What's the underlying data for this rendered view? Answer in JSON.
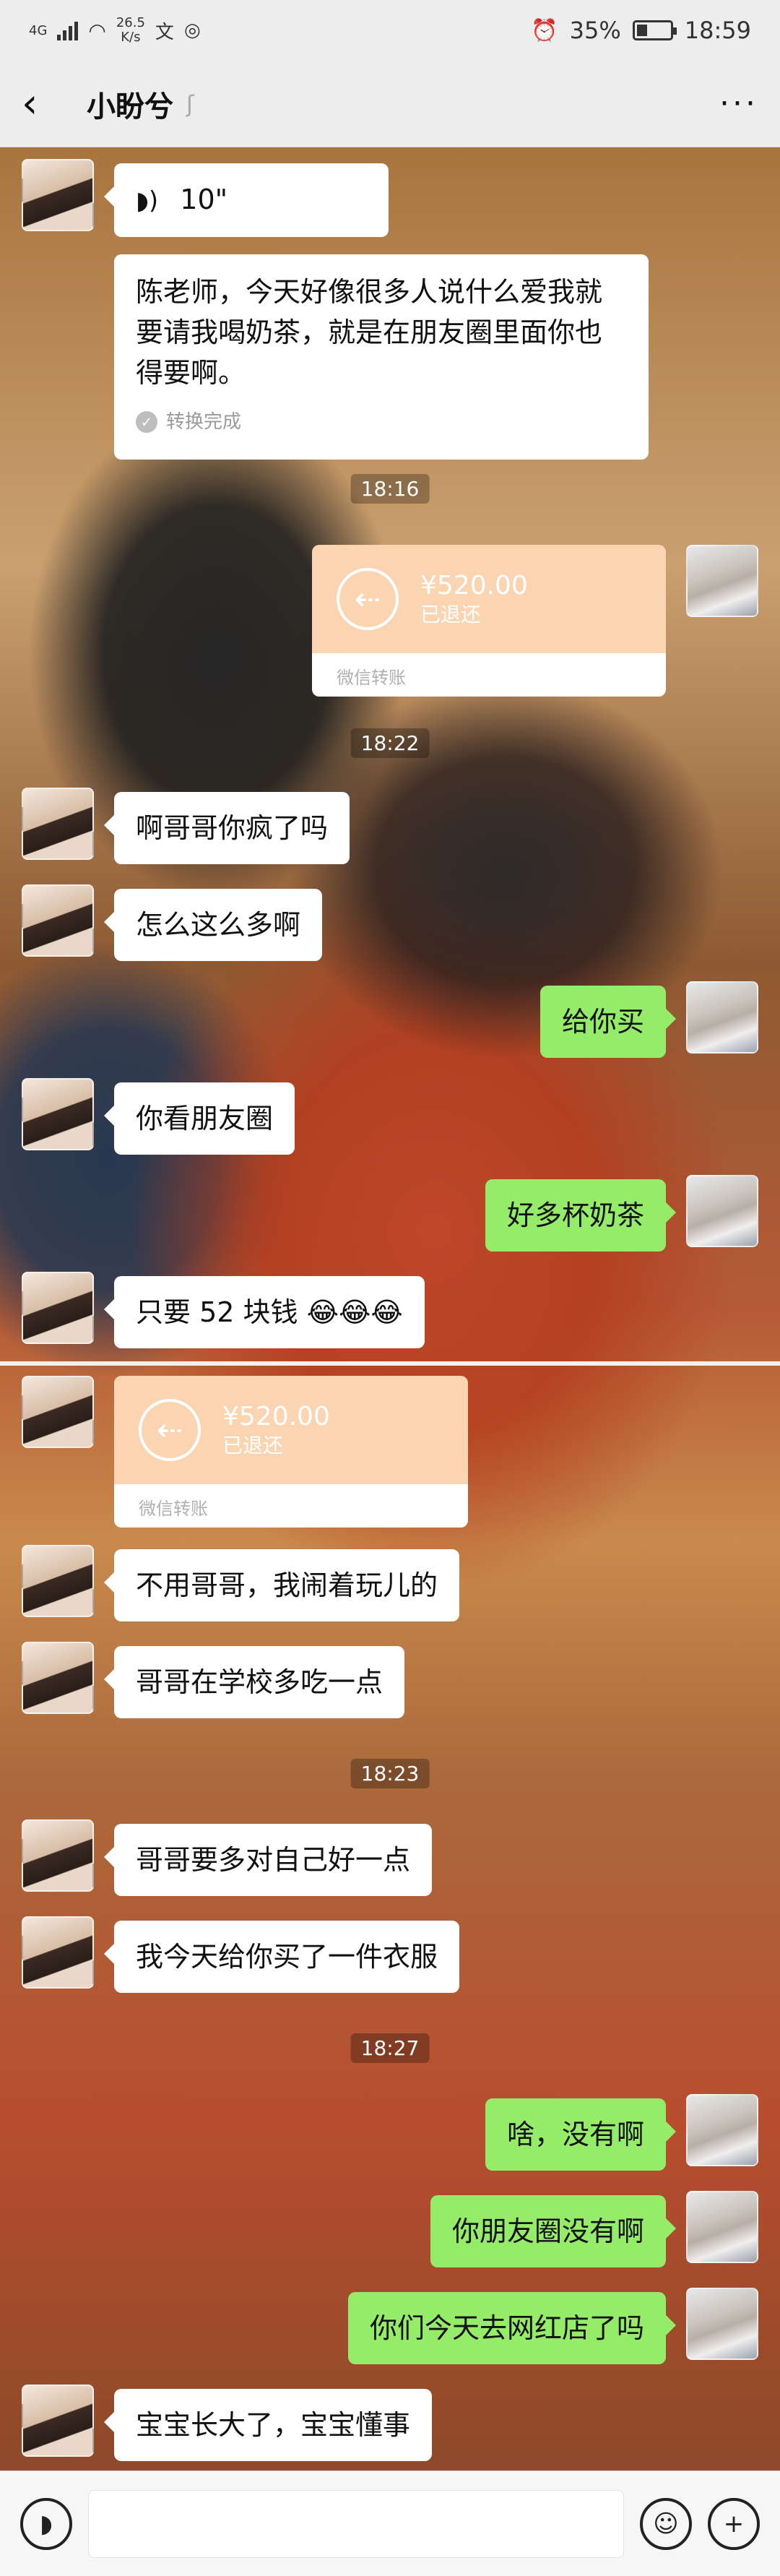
{
  "status_bar": {
    "network": "4G",
    "speed_value": "26.5",
    "speed_unit": "K/s",
    "battery": "35%",
    "time": "18:59"
  },
  "header": {
    "title": "小盼兮",
    "back_icon": "chevron-left-icon",
    "more_icon": "more-dots-icon"
  },
  "messages": {
    "voice_duration": "10\"",
    "voice_text": "陈老师，今天好像很多人说什么爱我就要请我喝奶茶，就是在朋友圈里面你也得要啊。",
    "convert_done": "转换完成",
    "time1": "18:16",
    "transfer1_amount": "¥520.00",
    "transfer1_status": "已退还",
    "transfer1_label": "微信转账",
    "time2": "18:22",
    "m1": "啊哥哥你疯了吗",
    "m2": "怎么这么多啊",
    "m3": "给你买",
    "m4": "你看朋友圈",
    "m5": "好多杯奶茶",
    "m6": "只要 52 块钱",
    "m6_emoji": "😂😂😂",
    "transfer2_amount": "¥520.00",
    "transfer2_status": "已退还",
    "transfer2_label": "微信转账",
    "m7": "不用哥哥，我闹着玩儿的",
    "m8": "哥哥在学校多吃一点",
    "time3": "18:23",
    "m9": "哥哥要多对自己好一点",
    "m10": "我今天给你买了一件衣服",
    "time4": "18:27",
    "m11": "啥，没有啊",
    "m12": "你朋友圈没有啊",
    "m13": "你们今天去网红店了吗",
    "m14": "宝宝长大了，宝宝懂事"
  },
  "input_bar": {
    "voice_icon": "voice-icon",
    "emoji_icon": "emoji-icon",
    "plus_icon": "plus-icon"
  },
  "colors": {
    "sent_bubble": "#95ec69",
    "received_bubble": "#ffffff",
    "transfer": "#fbd4b2"
  }
}
